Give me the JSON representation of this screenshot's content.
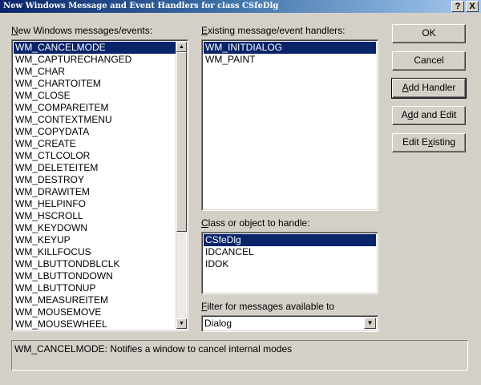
{
  "window": {
    "title": "New Windows Message and Event Handlers for class CSfeDlg",
    "help_btn": "?",
    "close_btn": "X"
  },
  "messages_panel": {
    "label_key": "N",
    "label_rest": "ew Windows messages/events:",
    "items": [
      "WM_CANCELMODE",
      "WM_CAPTURECHANGED",
      "WM_CHAR",
      "WM_CHARTOITEM",
      "WM_CLOSE",
      "WM_COMPAREITEM",
      "WM_CONTEXTMENU",
      "WM_COPYDATA",
      "WM_CREATE",
      "WM_CTLCOLOR",
      "WM_DELETEITEM",
      "WM_DESTROY",
      "WM_DRAWITEM",
      "WM_HELPINFO",
      "WM_HSCROLL",
      "WM_KEYDOWN",
      "WM_KEYUP",
      "WM_KILLFOCUS",
      "WM_LBUTTONDBLCLK",
      "WM_LBUTTONDOWN",
      "WM_LBUTTONUP",
      "WM_MEASUREITEM",
      "WM_MOUSEMOVE",
      "WM_MOUSEWHEEL"
    ],
    "selected_index": 0
  },
  "handlers_panel": {
    "label_key": "E",
    "label_rest": "xisting message/event handlers:",
    "items": [
      "WM_INITDIALOG",
      "WM_PAINT"
    ],
    "selected_index": 0
  },
  "class_panel": {
    "label_key": "C",
    "label_rest": "lass or object to handle:",
    "items": [
      "CSfeDlg",
      "IDCANCEL",
      "IDOK"
    ],
    "selected_index": 0
  },
  "filter": {
    "label_key": "F",
    "label_rest": "ilter for messages available to",
    "value": "Dialog"
  },
  "buttons": {
    "ok": "OK",
    "cancel": "Cancel",
    "add_handler_key": "A",
    "add_handler_rest": "dd Handler",
    "add_edit_pre": "A",
    "add_edit_key": "d",
    "add_edit_rest": "d and Edit",
    "edit_existing_pre": "Edit E",
    "edit_existing_key": "x",
    "edit_existing_rest": "isting"
  },
  "status": {
    "text": "WM_CANCELMODE:  Notifies a window to cancel internal modes"
  }
}
